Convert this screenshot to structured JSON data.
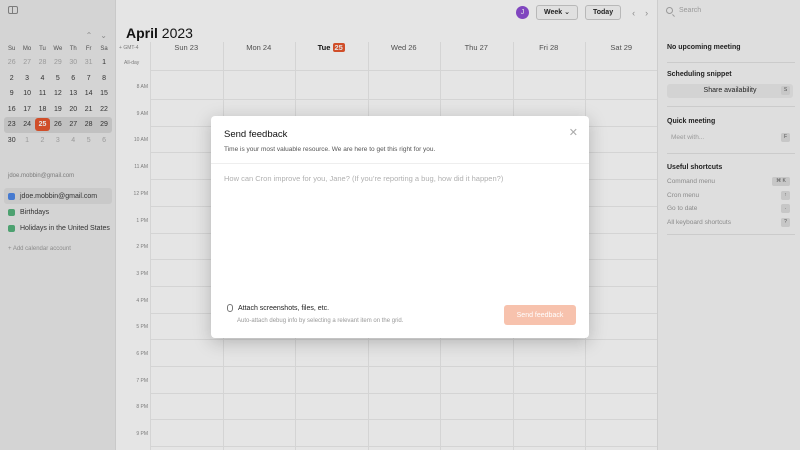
{
  "sidebar": {
    "weekday_headers": [
      "Su",
      "Mo",
      "Tu",
      "We",
      "Th",
      "Fr",
      "Sa"
    ],
    "weeks": [
      [
        "26",
        "27",
        "28",
        "29",
        "30",
        "31",
        "1"
      ],
      [
        "2",
        "3",
        "4",
        "5",
        "6",
        "7",
        "8"
      ],
      [
        "9",
        "10",
        "11",
        "12",
        "13",
        "14",
        "15"
      ],
      [
        "16",
        "17",
        "18",
        "19",
        "20",
        "21",
        "22"
      ],
      [
        "23",
        "24",
        "25",
        "26",
        "27",
        "28",
        "29"
      ],
      [
        "30",
        "1",
        "2",
        "3",
        "4",
        "5",
        "6"
      ]
    ],
    "account_email": "jdoe.mobbin@gmail.com",
    "calendars": [
      {
        "name": "jdoe.mobbin@gmail.com",
        "color": "#4a86e8"
      },
      {
        "name": "Birthdays",
        "color": "#53b27a"
      },
      {
        "name": "Holidays in the United States",
        "color": "#53b27a"
      }
    ],
    "add_calendar_label": "+ Add calendar account"
  },
  "header": {
    "month_name": "April",
    "year": "2023",
    "avatar_initial": "J",
    "view_label": "Week",
    "today_label": "Today",
    "search_placeholder": "Search"
  },
  "calendar": {
    "timezone": "GMT-4",
    "all_day_label": "All-day",
    "days": [
      {
        "name": "Sun",
        "date": "23"
      },
      {
        "name": "Mon",
        "date": "24"
      },
      {
        "name": "Tue",
        "date": "25",
        "today": true
      },
      {
        "name": "Wed",
        "date": "26"
      },
      {
        "name": "Thu",
        "date": "27"
      },
      {
        "name": "Fri",
        "date": "28"
      },
      {
        "name": "Sat",
        "date": "29"
      }
    ],
    "hours": [
      "8 AM",
      "9 AM",
      "10 AM",
      "11 AM",
      "12 PM",
      "1 PM",
      "2 PM",
      "3 PM",
      "4 PM",
      "5 PM",
      "6 PM",
      "7 PM",
      "8 PM",
      "9 PM"
    ]
  },
  "right_panel": {
    "no_events": "No upcoming meeting",
    "snippet_title": "Scheduling snippet",
    "share_label": "Share availability",
    "share_key": "S",
    "quick_title": "Quick meeting",
    "quick_placeholder": "Meet with...",
    "quick_key": "F",
    "shortcuts_title": "Useful shortcuts",
    "shortcuts": [
      {
        "label": "Command menu",
        "key": "⌘ K"
      },
      {
        "label": "Cron menu",
        "key": "↑"
      },
      {
        "label": "Go to date",
        "key": "."
      },
      {
        "label": "All keyboard shortcuts",
        "key": "?"
      }
    ]
  },
  "modal": {
    "title": "Send feedback",
    "subtitle": "Time is your most valuable resource. We are here to get this right for you.",
    "placeholder": "How can Cron improve for you, Jane? (If you’re reporting a bug, how did it happen?)",
    "attach_label": "Attach screenshots, files, etc.",
    "hint": "Auto-attach debug info by selecting a relevant item on the grid.",
    "send_label": "Send feedback",
    "send_color": "#f7c2ad"
  },
  "colors": {
    "accent": "#e8542a",
    "avatar": "#8c4bd4"
  }
}
